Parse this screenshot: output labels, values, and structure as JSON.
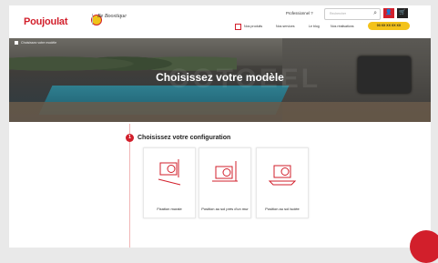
{
  "header": {
    "logo_text": "Poujoulat",
    "brand_subtitle": "Be Boostique",
    "account_label": "Professionnel ?",
    "search_placeholder": "Rechercher",
    "nav": [
      "Nos produits",
      "Nos services",
      "Le blog",
      "Nos réalisations"
    ],
    "phone": "03 XX XX XX XX"
  },
  "hero": {
    "breadcrumb": "Choisissez votre modèle",
    "title": "Choisissez votre modèle",
    "watermark": "OOTOEEL"
  },
  "config": {
    "step_number": "1",
    "title": "Choisissez votre configuration",
    "options": [
      {
        "label": "Fixation murale"
      },
      {
        "label": "Position au sol près d'un mur"
      },
      {
        "label": "Position au sol isolée"
      }
    ]
  },
  "colors": {
    "brand_red": "#d21f2b",
    "accent_yellow": "#f3c21a"
  }
}
